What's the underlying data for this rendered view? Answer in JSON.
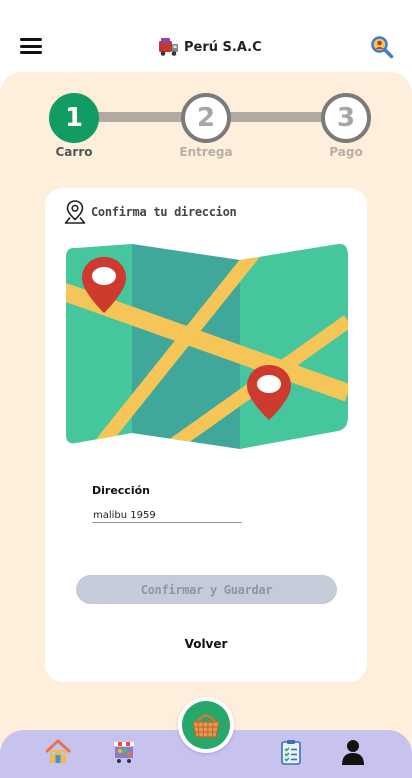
{
  "header": {
    "brand_name": "Perú S.A.C"
  },
  "stepper": {
    "steps": [
      {
        "number": "1",
        "label": "Carro",
        "state": "active"
      },
      {
        "number": "2",
        "label": "Entrega",
        "state": "inactive"
      },
      {
        "number": "3",
        "label": "Pago",
        "state": "inactive"
      }
    ]
  },
  "card": {
    "title": "Confirma tu direccion",
    "field_label": "Dirección",
    "address_value": "malibu 1959",
    "confirm_label": "Confirmar y Guardar",
    "back_label": "Volver"
  },
  "colors": {
    "primary_green": "#109c63",
    "panel_bg": "#fdefdc",
    "nav_bg": "#c8c2ee",
    "button_disabled": "#c5cbd8"
  },
  "icons": {
    "menu": "hamburger-icon",
    "brand_logo": "delivery-truck-icon",
    "search": "search-icon",
    "location": "location-pin-icon",
    "map": "folded-map-illustration",
    "nav_home": "house-icon",
    "nav_store": "market-cart-icon",
    "nav_basket": "basket-icon",
    "nav_orders": "clipboard-list-icon",
    "nav_profile": "user-icon"
  }
}
